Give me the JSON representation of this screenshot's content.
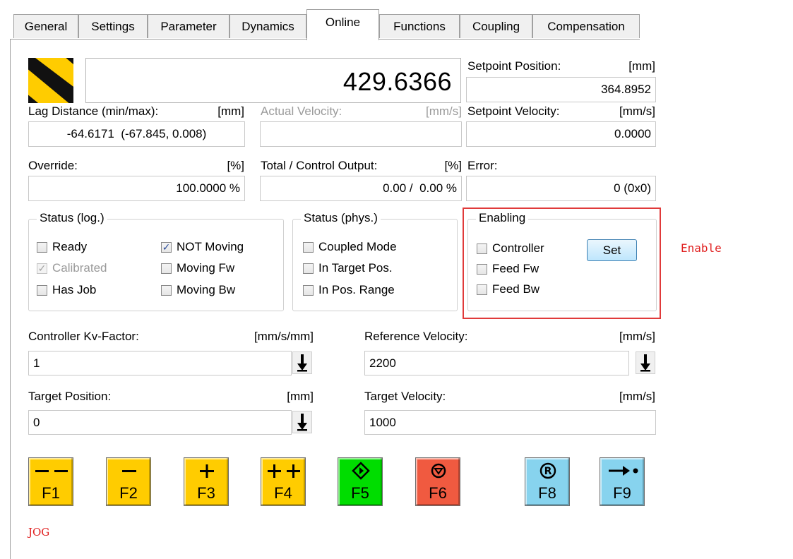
{
  "tabs": [
    "General",
    "Settings",
    "Parameter",
    "Dynamics",
    "Online",
    "Functions",
    "Coupling",
    "Compensation"
  ],
  "active_tab": "Online",
  "actual_position": "429.6366",
  "setpoint_position": {
    "label": "Setpoint Position:",
    "unit": "[mm]",
    "value": "364.8952"
  },
  "lag_distance": {
    "label": "Lag Distance (min/max):",
    "unit": "[mm]",
    "value": "-64.6171  (-67.845, 0.008)"
  },
  "actual_velocity": {
    "label": "Actual Velocity:",
    "unit": "[mm/s]",
    "value": ""
  },
  "setpoint_velocity": {
    "label": "Setpoint Velocity:",
    "unit": "[mm/s]",
    "value": "0.0000"
  },
  "override": {
    "label": "Override:",
    "unit": "[%]",
    "value": "100.0000 %"
  },
  "total_output": {
    "label": "Total / Control Output:",
    "unit": "[%]",
    "value": "0.00 /  0.00 %"
  },
  "error": {
    "label": "Error:",
    "value": "0 (0x0)"
  },
  "status_log": {
    "title": "Status (log.)",
    "items": [
      {
        "label": "Ready",
        "checked": false,
        "disabled": false
      },
      {
        "label": "Calibrated",
        "checked": true,
        "disabled": true
      },
      {
        "label": "Has Job",
        "checked": false,
        "disabled": false
      },
      {
        "label": "NOT Moving",
        "checked": true,
        "disabled": false
      },
      {
        "label": "Moving Fw",
        "checked": false,
        "disabled": false
      },
      {
        "label": "Moving Bw",
        "checked": false,
        "disabled": false
      }
    ]
  },
  "status_phys": {
    "title": "Status (phys.)",
    "items": [
      {
        "label": "Coupled Mode",
        "checked": false
      },
      {
        "label": "In Target Pos.",
        "checked": false
      },
      {
        "label": "In Pos. Range",
        "checked": false
      }
    ]
  },
  "enabling": {
    "title": "Enabling",
    "items": [
      {
        "label": "Controller",
        "checked": false
      },
      {
        "label": "Feed Fw",
        "checked": false
      },
      {
        "label": "Feed Bw",
        "checked": false
      }
    ],
    "set_label": "Set"
  },
  "annotation_enable": "Enable",
  "kv_factor": {
    "label": "Controller Kv-Factor:",
    "unit": "[mm/s/mm]",
    "value": "1"
  },
  "reference_velocity": {
    "label": "Reference Velocity:",
    "unit": "[mm/s]",
    "value": "2200"
  },
  "target_position": {
    "label": "Target Position:",
    "unit": "[mm]",
    "value": "0"
  },
  "target_velocity": {
    "label": "Target Velocity:",
    "unit": "[mm/s]",
    "value": "1000"
  },
  "function_keys": [
    {
      "label": "F1",
      "symbol": "— —",
      "color": "#ffcc00"
    },
    {
      "label": "F2",
      "symbol": "—",
      "color": "#ffcc00"
    },
    {
      "label": "F3",
      "symbol": "+",
      "color": "#ffcc00"
    },
    {
      "label": "F4",
      "symbol": "++",
      "color": "#ffcc00"
    },
    {
      "label": "F5",
      "symbol": "start-diamond-icon",
      "color": "#00dd00"
    },
    {
      "label": "F6",
      "symbol": "stop-circle-icon",
      "color": "#f05a40"
    },
    {
      "label": "F8",
      "symbol": "reset-r-icon",
      "color": "#87d3ee"
    },
    {
      "label": "F9",
      "symbol": "arrow-dot-icon",
      "color": "#87d3ee"
    }
  ],
  "annotation_jog": "JOG"
}
